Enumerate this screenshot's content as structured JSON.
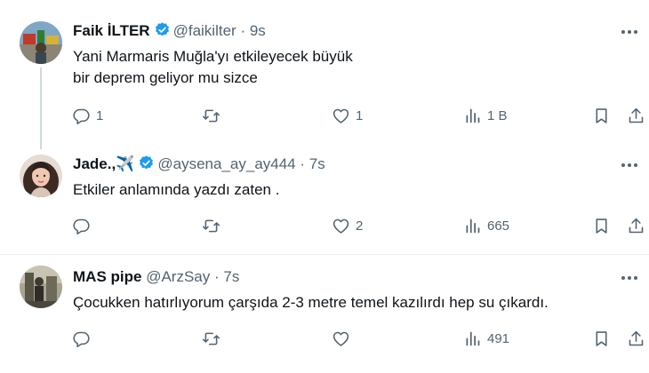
{
  "tweets": [
    {
      "name": "Faik İLTER",
      "handle": "@faikilter",
      "dot": "·",
      "time": "9s",
      "text": "Yani Marmaris Muğla'yı etkileyecek büyük\n bir deprem geliyor mu sizce",
      "verified": true,
      "emoji": "",
      "actions": {
        "reply": "1",
        "retweet": "",
        "like": "1",
        "views": "1 B"
      }
    },
    {
      "name": "Jade.,",
      "handle": "@aysena_ay_ay444",
      "dot": "·",
      "time": "7s",
      "text": "Etkiler anlamında yazdı zaten .",
      "verified": true,
      "emoji": "✈️",
      "actions": {
        "reply": "",
        "retweet": "",
        "like": "2",
        "views": "665"
      }
    },
    {
      "name": "MAS pipe",
      "handle": "@ArzSay",
      "dot": "·",
      "time": "7s",
      "text": "Çocukken hatırlıyorum çarşıda 2-3 metre temel kazılırdı hep su çıkardı.",
      "verified": false,
      "emoji": "",
      "actions": {
        "reply": "",
        "retweet": "",
        "like": "",
        "views": "491"
      }
    }
  ],
  "colors": {
    "verified": "#1d9bf0",
    "muted": "#536471",
    "text": "#0f1419",
    "thread_line": "#cfd9de"
  },
  "icons": [
    "verified-badge-icon",
    "more-icon",
    "reply-icon",
    "retweet-icon",
    "like-icon",
    "views-icon",
    "bookmark-icon",
    "share-icon"
  ]
}
